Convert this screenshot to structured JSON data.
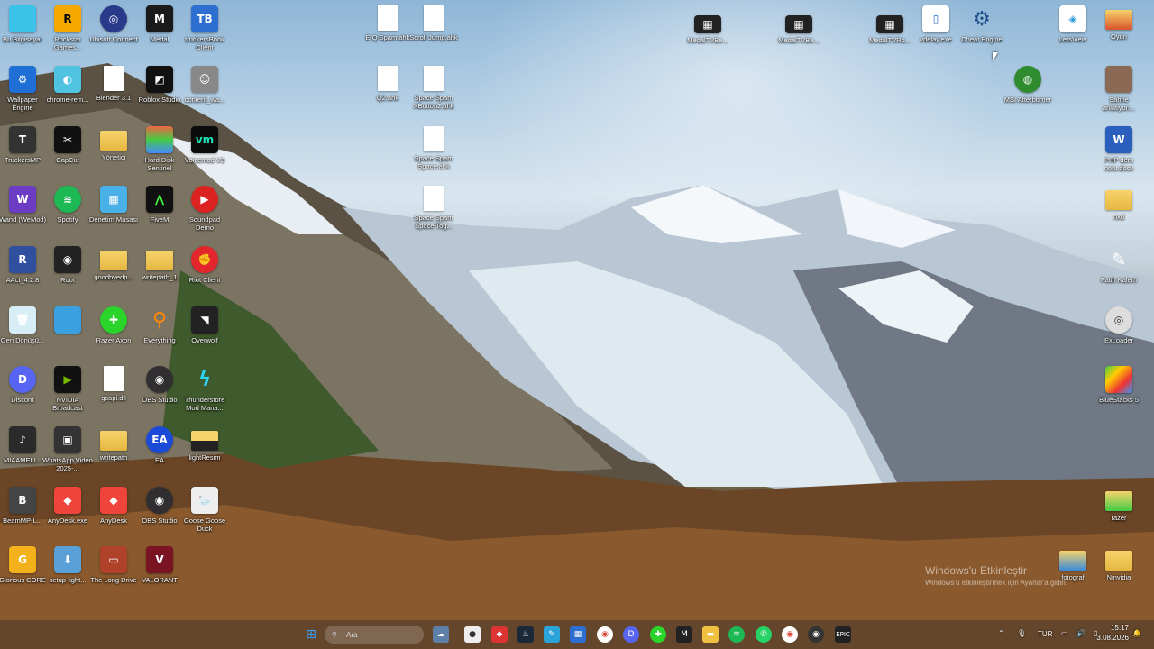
{
  "desktop_icons": {
    "col1": [
      "Bu Bilgisayar",
      "Wallpaper Engine",
      "TruckersMP",
      "Wand (WeMod)",
      "AAct_4.2.8",
      "Geri Dönüşü...",
      "Discord",
      "MIAAMELI...",
      "BeamMP-L...",
      "Glorious CORE"
    ],
    "col2": [
      "Rockstar Games...",
      "chrome-rem...",
      "CapCut",
      "Spotify",
      "Root",
      "",
      "NVIDIA Broadcast",
      "WhatsApp Video 2025-...",
      "AnyDesk.exe",
      "setup-light..."
    ],
    "col3": [
      "Ubisoft Connect",
      "Blender 3.1",
      "Yönetici",
      "Denetim Masası",
      "goodbyedp...",
      "Razer Axon",
      "gcapi.dll",
      "writepath",
      "AnyDesk",
      "The Long Drive"
    ],
    "col4": [
      "Medal",
      "Roblox Studio",
      "Hard Disk Sentinel",
      "FiveM",
      "writepath_1",
      "Everything",
      "OBS Studio",
      "EA",
      "OBS Studio",
      "VALORANT"
    ],
    "col5": [
      "truckersBook Client",
      "content_wa...",
      "Voicemod V3",
      "Soundpad Demo",
      "Riot Client",
      "Overwolf",
      "Thunderstore Mod Mana...",
      "lightResim",
      "Goose Goose Duck"
    ],
    "mid_files": [
      "E Q Spam.ahk",
      "Scroll Jump.ahk",
      "Q2.ahk",
      "Space Spam XButton2.ahk",
      "Space Spam Space.ahk",
      "Space Spam Space Tog..."
    ],
    "top_right": [
      "MedalTVBe...",
      "MedalTVBe...",
      "MedalTVRo...",
      "vdelay.exe",
      "Cheat Engine",
      "LetsView",
      "Oyun"
    ],
    "right_col": [
      "MSI Afterburner",
      "Sahne anlatiyon...",
      "PHP ders notu.docx",
      "nxd",
      "Fatih Kalem",
      "ExLoader",
      "BlueStacks 5",
      "razer",
      "fotograf",
      "Ninvidia"
    ]
  },
  "watermark": {
    "line1": "Windows'u Etkinleştir",
    "line2": "Windows'u etkinleştirmek için Ayarlar'a gidin."
  },
  "taskbar": {
    "search_placeholder": "Ara",
    "language": "TUR",
    "time": "15:17",
    "date": "3.08.2026"
  },
  "colors": {
    "accent": "#1f8be0",
    "taskbar": "#1e2228"
  }
}
